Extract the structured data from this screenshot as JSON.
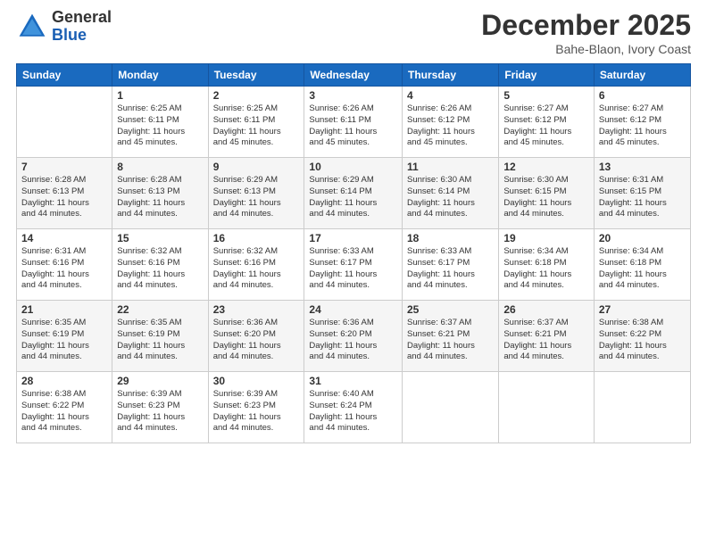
{
  "logo": {
    "general": "General",
    "blue": "Blue"
  },
  "header": {
    "month": "December 2025",
    "location": "Bahe-Blaon, Ivory Coast"
  },
  "weekdays": [
    "Sunday",
    "Monday",
    "Tuesday",
    "Wednesday",
    "Thursday",
    "Friday",
    "Saturday"
  ],
  "weeks": [
    [
      {
        "day": "",
        "info": ""
      },
      {
        "day": "1",
        "info": "Sunrise: 6:25 AM\nSunset: 6:11 PM\nDaylight: 11 hours\nand 45 minutes."
      },
      {
        "day": "2",
        "info": "Sunrise: 6:25 AM\nSunset: 6:11 PM\nDaylight: 11 hours\nand 45 minutes."
      },
      {
        "day": "3",
        "info": "Sunrise: 6:26 AM\nSunset: 6:11 PM\nDaylight: 11 hours\nand 45 minutes."
      },
      {
        "day": "4",
        "info": "Sunrise: 6:26 AM\nSunset: 6:12 PM\nDaylight: 11 hours\nand 45 minutes."
      },
      {
        "day": "5",
        "info": "Sunrise: 6:27 AM\nSunset: 6:12 PM\nDaylight: 11 hours\nand 45 minutes."
      },
      {
        "day": "6",
        "info": "Sunrise: 6:27 AM\nSunset: 6:12 PM\nDaylight: 11 hours\nand 45 minutes."
      }
    ],
    [
      {
        "day": "7",
        "info": "Sunrise: 6:28 AM\nSunset: 6:13 PM\nDaylight: 11 hours\nand 44 minutes."
      },
      {
        "day": "8",
        "info": "Sunrise: 6:28 AM\nSunset: 6:13 PM\nDaylight: 11 hours\nand 44 minutes."
      },
      {
        "day": "9",
        "info": "Sunrise: 6:29 AM\nSunset: 6:13 PM\nDaylight: 11 hours\nand 44 minutes."
      },
      {
        "day": "10",
        "info": "Sunrise: 6:29 AM\nSunset: 6:14 PM\nDaylight: 11 hours\nand 44 minutes."
      },
      {
        "day": "11",
        "info": "Sunrise: 6:30 AM\nSunset: 6:14 PM\nDaylight: 11 hours\nand 44 minutes."
      },
      {
        "day": "12",
        "info": "Sunrise: 6:30 AM\nSunset: 6:15 PM\nDaylight: 11 hours\nand 44 minutes."
      },
      {
        "day": "13",
        "info": "Sunrise: 6:31 AM\nSunset: 6:15 PM\nDaylight: 11 hours\nand 44 minutes."
      }
    ],
    [
      {
        "day": "14",
        "info": "Sunrise: 6:31 AM\nSunset: 6:16 PM\nDaylight: 11 hours\nand 44 minutes."
      },
      {
        "day": "15",
        "info": "Sunrise: 6:32 AM\nSunset: 6:16 PM\nDaylight: 11 hours\nand 44 minutes."
      },
      {
        "day": "16",
        "info": "Sunrise: 6:32 AM\nSunset: 6:16 PM\nDaylight: 11 hours\nand 44 minutes."
      },
      {
        "day": "17",
        "info": "Sunrise: 6:33 AM\nSunset: 6:17 PM\nDaylight: 11 hours\nand 44 minutes."
      },
      {
        "day": "18",
        "info": "Sunrise: 6:33 AM\nSunset: 6:17 PM\nDaylight: 11 hours\nand 44 minutes."
      },
      {
        "day": "19",
        "info": "Sunrise: 6:34 AM\nSunset: 6:18 PM\nDaylight: 11 hours\nand 44 minutes."
      },
      {
        "day": "20",
        "info": "Sunrise: 6:34 AM\nSunset: 6:18 PM\nDaylight: 11 hours\nand 44 minutes."
      }
    ],
    [
      {
        "day": "21",
        "info": "Sunrise: 6:35 AM\nSunset: 6:19 PM\nDaylight: 11 hours\nand 44 minutes."
      },
      {
        "day": "22",
        "info": "Sunrise: 6:35 AM\nSunset: 6:19 PM\nDaylight: 11 hours\nand 44 minutes."
      },
      {
        "day": "23",
        "info": "Sunrise: 6:36 AM\nSunset: 6:20 PM\nDaylight: 11 hours\nand 44 minutes."
      },
      {
        "day": "24",
        "info": "Sunrise: 6:36 AM\nSunset: 6:20 PM\nDaylight: 11 hours\nand 44 minutes."
      },
      {
        "day": "25",
        "info": "Sunrise: 6:37 AM\nSunset: 6:21 PM\nDaylight: 11 hours\nand 44 minutes."
      },
      {
        "day": "26",
        "info": "Sunrise: 6:37 AM\nSunset: 6:21 PM\nDaylight: 11 hours\nand 44 minutes."
      },
      {
        "day": "27",
        "info": "Sunrise: 6:38 AM\nSunset: 6:22 PM\nDaylight: 11 hours\nand 44 minutes."
      }
    ],
    [
      {
        "day": "28",
        "info": "Sunrise: 6:38 AM\nSunset: 6:22 PM\nDaylight: 11 hours\nand 44 minutes."
      },
      {
        "day": "29",
        "info": "Sunrise: 6:39 AM\nSunset: 6:23 PM\nDaylight: 11 hours\nand 44 minutes."
      },
      {
        "day": "30",
        "info": "Sunrise: 6:39 AM\nSunset: 6:23 PM\nDaylight: 11 hours\nand 44 minutes."
      },
      {
        "day": "31",
        "info": "Sunrise: 6:40 AM\nSunset: 6:24 PM\nDaylight: 11 hours\nand 44 minutes."
      },
      {
        "day": "",
        "info": ""
      },
      {
        "day": "",
        "info": ""
      },
      {
        "day": "",
        "info": ""
      }
    ]
  ]
}
